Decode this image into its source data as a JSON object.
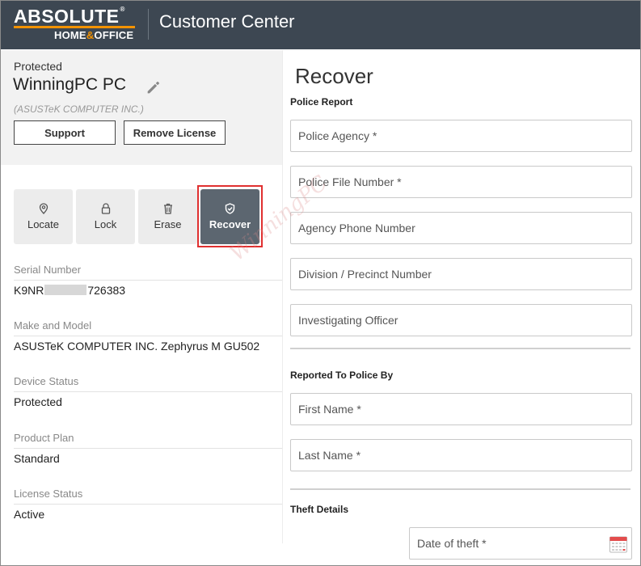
{
  "header": {
    "logo_top": "ABSOLUTE",
    "logo_reg": "®",
    "logo_bottom_1": "HOME",
    "logo_bottom_amp": "&",
    "logo_bottom_2": "OFFICE",
    "title": "Customer Center"
  },
  "device": {
    "status_label": "Protected",
    "name": "WinningPC PC",
    "manufacturer": "(ASUSTeK COMPUTER INC.)",
    "support_label": "Support",
    "remove_label": "Remove License"
  },
  "actions": {
    "locate": "Locate",
    "lock": "Lock",
    "erase": "Erase",
    "recover": "Recover"
  },
  "info": {
    "serial_label": "Serial Number",
    "serial_prefix": "K9NR",
    "serial_suffix": "726383",
    "model_label": "Make and Model",
    "model_value": "ASUSTeK COMPUTER INC. Zephyrus M GU502",
    "status_label": "Device Status",
    "status_value": "Protected",
    "plan_label": "Product Plan",
    "plan_value": "Standard",
    "license_label": "License Status",
    "license_value": "Active"
  },
  "recover": {
    "title": "Recover",
    "police_report_title": "Police Report",
    "police_agency": "Police Agency *",
    "police_file": "Police File Number *",
    "agency_phone": "Agency Phone Number",
    "division": "Division / Precinct Number",
    "officer": "Investigating Officer",
    "reported_by_title": "Reported To Police By",
    "first_name": "First Name *",
    "last_name": "Last Name *",
    "theft_details_title": "Theft Details",
    "date_of_theft": "Date of theft *"
  },
  "watermark": "WinningPC",
  "colors": {
    "header_bg": "#3d4752",
    "brand_orange": "#f39200",
    "active_tile": "#5c6670",
    "highlight": "#e03030"
  }
}
